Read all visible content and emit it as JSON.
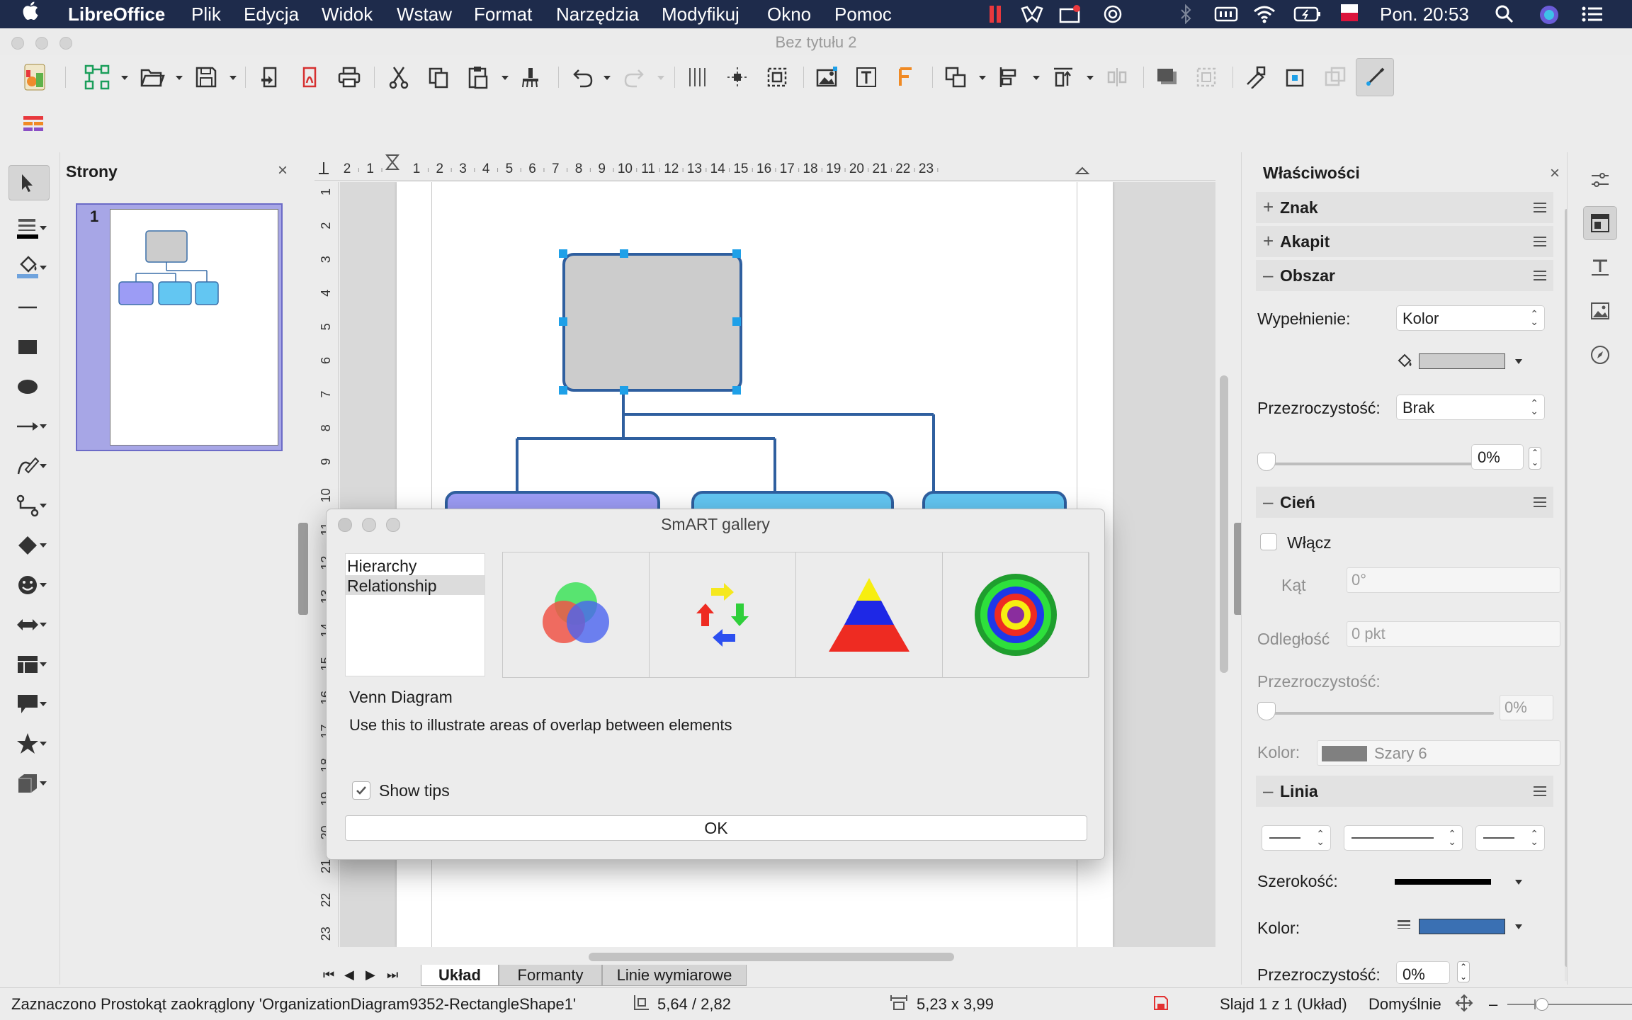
{
  "menubar": {
    "app": "LibreOffice",
    "items": [
      "Plik",
      "Edycja",
      "Widok",
      "Wstaw",
      "Format",
      "Narzędzia",
      "Modyfikuj",
      "Okno",
      "Pomoc"
    ],
    "clock": "Pon. 20:53"
  },
  "window": {
    "title": "Bez tytułu 2"
  },
  "slides_panel": {
    "title": "Strony",
    "slide_number": "1"
  },
  "ruler": {
    "h_ticks": [
      "2",
      "1",
      "1",
      "2",
      "3",
      "4",
      "5",
      "6",
      "7",
      "8",
      "9",
      "10",
      "11",
      "12",
      "13",
      "14",
      "15",
      "16",
      "17",
      "18",
      "19",
      "20",
      "21",
      "22",
      "23"
    ],
    "v_ticks": [
      "1",
      "2",
      "3",
      "4",
      "5",
      "6",
      "7",
      "8",
      "9",
      "10",
      "11",
      "12",
      "13",
      "14",
      "15",
      "16",
      "17",
      "18",
      "19",
      "20",
      "21",
      "22",
      "23"
    ]
  },
  "layer_tabs": {
    "tabs": [
      "Układ",
      "Formanty",
      "Linie wymiarowe"
    ],
    "active": "Układ"
  },
  "sidebar": {
    "title": "Właściwości",
    "sections": {
      "znak": "Znak",
      "akapit": "Akapit",
      "obszar": "Obszar",
      "cien": "Cień",
      "linia": "Linia"
    },
    "fill_label": "Wypełnienie:",
    "fill_value": "Kolor",
    "fill_color": "#cccccc",
    "transparency_label": "Przezroczystość:",
    "transparency_value": "Brak",
    "transparency_percent": "0%",
    "shadow_enable": "Włącz",
    "shadow_angle_label": "Kąt",
    "shadow_angle_value": "0°",
    "shadow_distance_label": "Odległość",
    "shadow_distance_value": "0 pkt",
    "shadow_transparency_label": "Przezroczystość:",
    "shadow_transparency_value": "0%",
    "shadow_color_label": "Kolor:",
    "shadow_color_value": "Szary 6",
    "shadow_color": "#808080",
    "line_width_label": "Szerokość:",
    "line_color_label": "Kolor:",
    "line_color": "#3a70b3",
    "line_transparency_label": "Przezroczystość:",
    "line_transparency_value": "0%"
  },
  "dialog": {
    "title": "SmART gallery",
    "categories": [
      "Hierarchy",
      "Relationship"
    ],
    "selected_category": "Relationship",
    "diagram_name": "Venn Diagram",
    "diagram_description": "Use this to illustrate areas of overlap between elements",
    "show_tips_label": "Show tips",
    "show_tips_checked": true,
    "ok_label": "OK"
  },
  "statusbar": {
    "selection": "Zaznaczono Prostokąt zaokrąglony 'OrganizationDiagram9352-RectangleShape1'",
    "position": "5,64 / 2,82",
    "size": "5,23 x 3,99",
    "slide_info": "Slajd 1 z 1 (Układ)",
    "master": "Domyślnie"
  },
  "colors": {
    "menubar_bg": "#1e2b4b",
    "shape_stroke": "#2f5f9f",
    "selected_shape_fill": "#cccccc",
    "box_purple": "#9c9cf5",
    "box_cyan": "#63c6f2",
    "handle": "#1ea0e8"
  }
}
